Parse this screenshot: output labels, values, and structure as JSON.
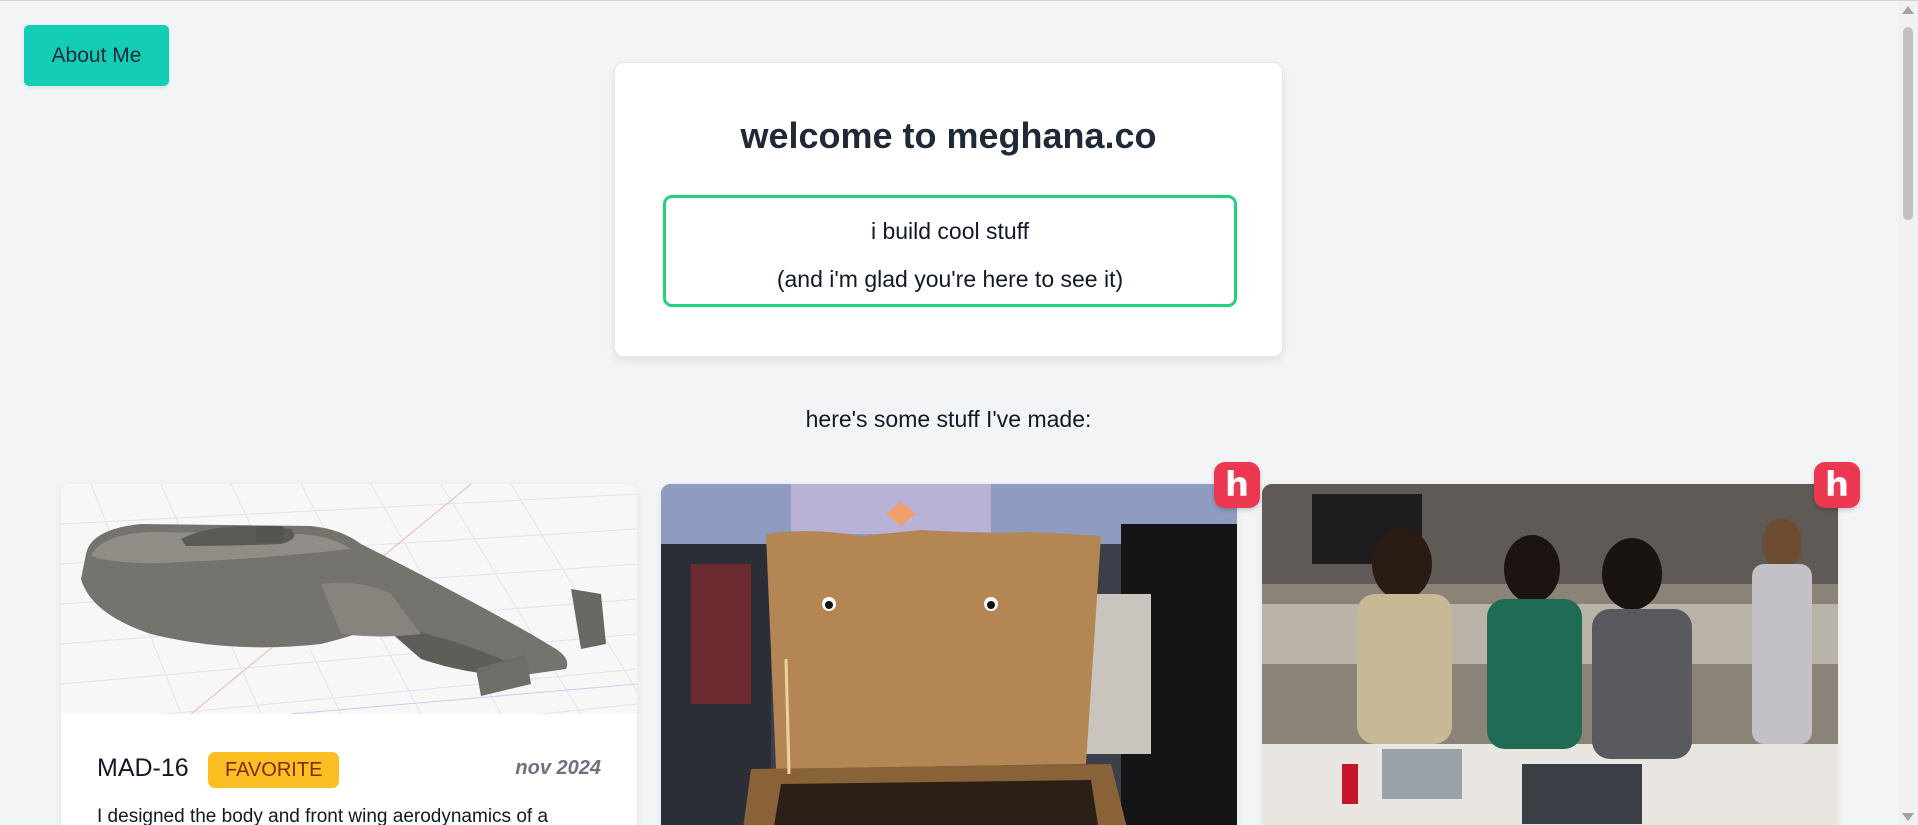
{
  "nav": {
    "about_label": "About Me"
  },
  "hero": {
    "title": "welcome to meghana.co",
    "tagline_line1": "i build cool stuff",
    "tagline_line2": "(and i'm glad you're here to see it)"
  },
  "projects_heading": "here's some stuff I've made:",
  "projects": [
    {
      "title": "MAD-16",
      "badge": "FAVORITE",
      "date": "nov 2024",
      "description": "I designed the body and front wing aerodynamics of a"
    },
    {
      "title": "",
      "badge_icon": "h-logo-icon"
    },
    {
      "title": "",
      "badge_icon": "h-logo-icon"
    }
  ],
  "h_badge_letter": "h",
  "colors": {
    "accent_teal": "#14cdb7",
    "tagline_border": "#22d17a",
    "favorite_badge": "#fbbf24",
    "h_badge": "#ec3750"
  }
}
